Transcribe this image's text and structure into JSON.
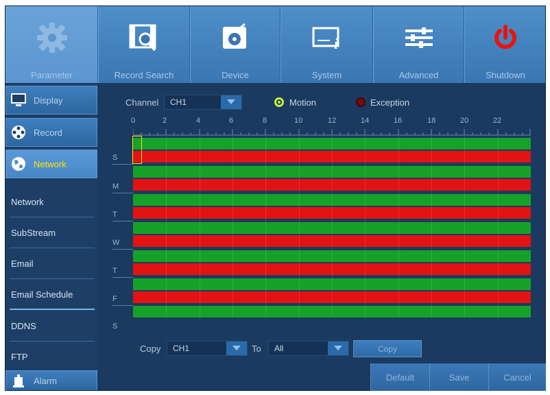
{
  "topnav": {
    "tabs": [
      {
        "label": "Parameter",
        "icon": "gear-icon",
        "active": true
      },
      {
        "label": "Record Search",
        "icon": "film-search-icon"
      },
      {
        "label": "Device",
        "icon": "disk-icon"
      },
      {
        "label": "System",
        "icon": "system-info-icon"
      },
      {
        "label": "Advanced",
        "icon": "sliders-icon"
      },
      {
        "label": "Shutdown",
        "icon": "power-icon"
      }
    ]
  },
  "sidebar": {
    "categories": {
      "display": "Display",
      "record": "Record",
      "network": "Network",
      "alarm": "Alarm"
    },
    "subitems": [
      "Network",
      "SubStream",
      "Email",
      "Email Schedule",
      "DDNS",
      "FTP"
    ]
  },
  "schedule": {
    "channel_label": "Channel",
    "channel_value": "CH1",
    "legend": {
      "motion": "Motion",
      "exception": "Exception"
    },
    "hours": [
      "0",
      "2",
      "4",
      "6",
      "8",
      "10",
      "12",
      "14",
      "16",
      "18",
      "20",
      "22"
    ],
    "days": [
      "S",
      "M",
      "T",
      "W",
      "T",
      "F",
      "S"
    ],
    "colors": {
      "motion": "#16a128",
      "exception": "#e21313",
      "selected": "#ffe600"
    }
  },
  "copy": {
    "copy_label": "Copy",
    "from_value": "CH1",
    "to_label": "To",
    "to_value": "All",
    "copy_button": "Copy"
  },
  "actions": {
    "default": "Default",
    "save": "Save",
    "cancel": "Cancel"
  }
}
